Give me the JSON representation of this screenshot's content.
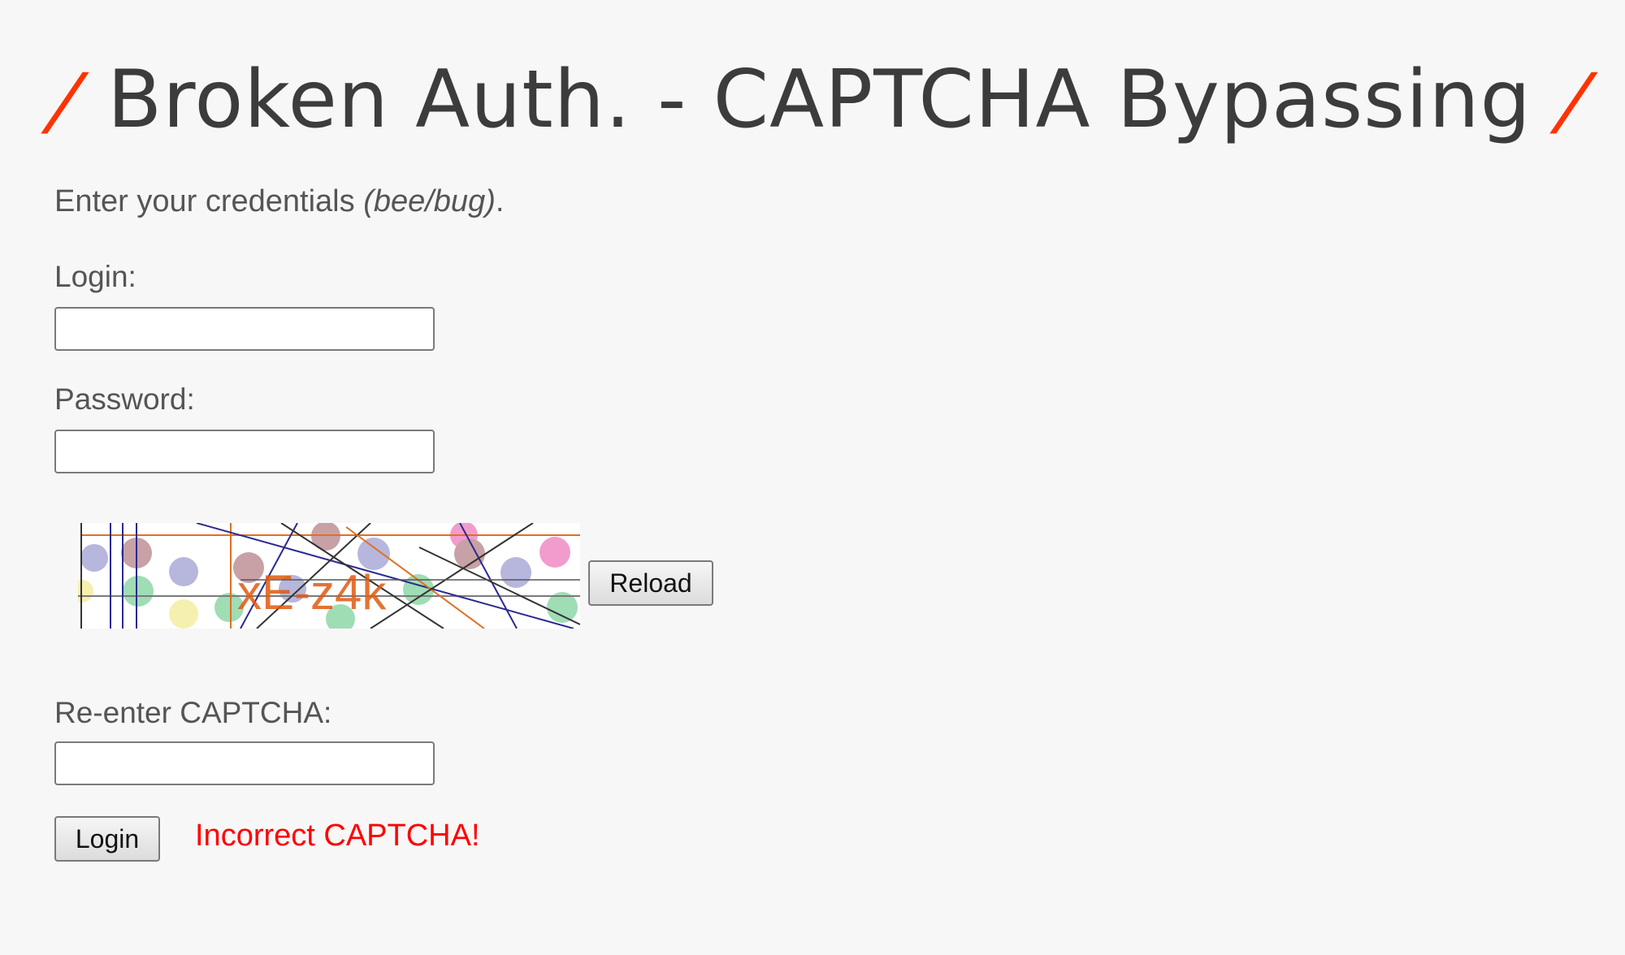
{
  "header": {
    "title": "Broken Auth. - CAPTCHA Bypassing",
    "slash_left": "/",
    "slash_right": "/",
    "accent_color": "#ff3300"
  },
  "form": {
    "intro_text": "Enter your credentials ",
    "intro_hint": "(bee/bug)",
    "intro_suffix": ".",
    "login_label": "Login:",
    "login_value": "",
    "password_label": "Password:",
    "password_value": "",
    "captcha_text": "xE-z4k",
    "reload_label": "Reload",
    "captcha_reenter_label": "Re-enter CAPTCHA:",
    "captcha_value": "",
    "submit_label": "Login",
    "error_message": "Incorrect CAPTCHA!",
    "error_color": "#ff0000"
  }
}
